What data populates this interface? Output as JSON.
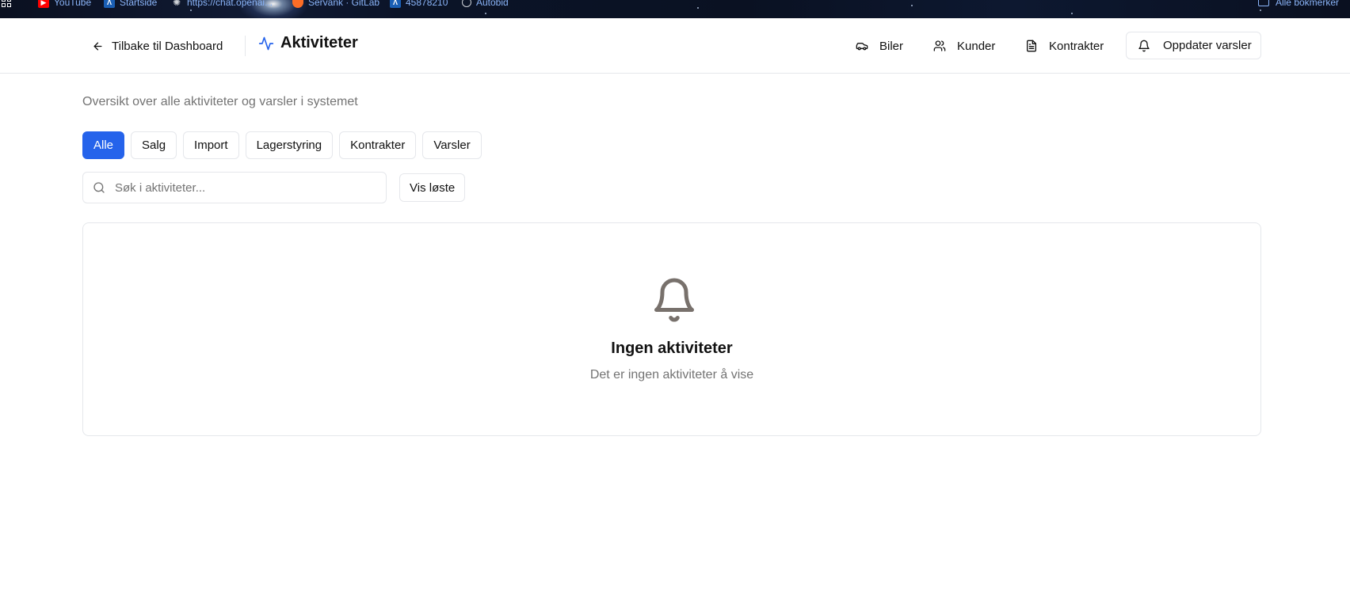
{
  "bookmarks_bar": {
    "items": [
      {
        "label": "YouTube",
        "icon": "youtube-icon",
        "color": "#ff0000"
      },
      {
        "label": "Startside",
        "icon": "lambda-icon",
        "color": "#1a5fb4"
      },
      {
        "label": "https://chat.openai...",
        "icon": "openai-icon",
        "color": "#9aa0a6"
      },
      {
        "label": "Servank · GitLab",
        "icon": "gitlab-icon",
        "color": "#fc6d26"
      },
      {
        "label": "45878210",
        "icon": "lambda-icon",
        "color": "#1a5fb4"
      },
      {
        "label": "Autobid",
        "icon": "autobid-icon",
        "color": "#9aa0a6"
      }
    ],
    "all_bookmarks": "Alle bokmerker"
  },
  "header": {
    "back_label": "Tilbake til Dashboard",
    "title": "Aktiviteter",
    "nav": {
      "biler": "Biler",
      "kunder": "Kunder",
      "kontrakter": "Kontrakter"
    },
    "refresh_label": "Oppdater varsler"
  },
  "subtitle": "Oversikt over alle aktiviteter og varsler i systemet",
  "filters": {
    "active": "Alle",
    "items": [
      "Alle",
      "Salg",
      "Import",
      "Lagerstyring",
      "Kontrakter",
      "Varsler"
    ]
  },
  "search": {
    "placeholder": "Søk i aktiviteter...",
    "value": ""
  },
  "show_resolved_label": "Vis løste",
  "empty_state": {
    "icon": "bell-icon",
    "title": "Ingen aktiviteter",
    "description": "Det er ingen aktiviteter å vise"
  },
  "colors": {
    "accent": "#2563eb",
    "muted_text": "#737373",
    "border": "#e5e7eb"
  }
}
